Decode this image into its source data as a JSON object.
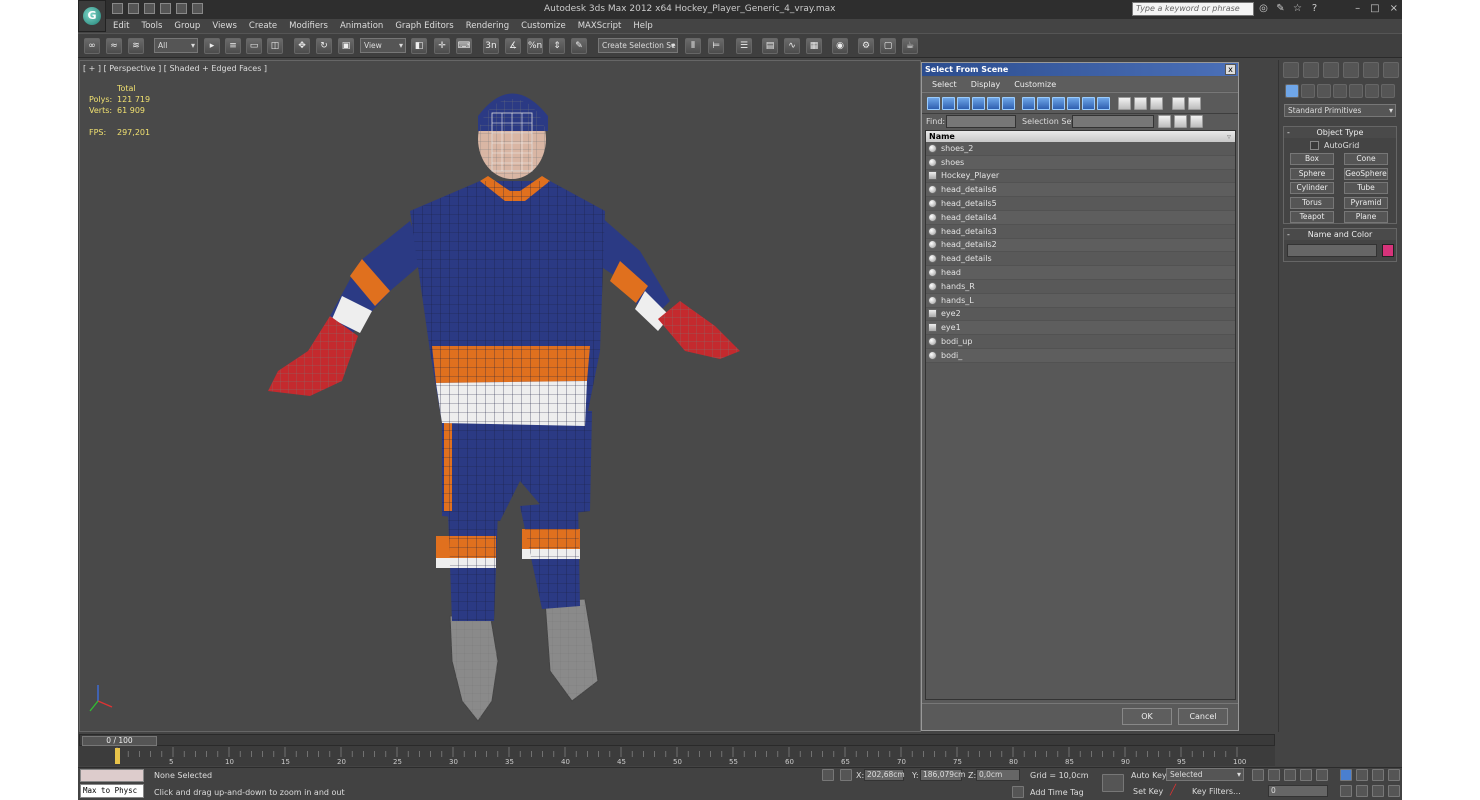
{
  "app": {
    "title": "Autodesk 3ds Max  2012 x64     Hockey_Player_Generic_4_vray.max",
    "logo_glyph": "G",
    "search_placeholder": "Type a keyword or phrase",
    "window_controls": [
      "–",
      "□",
      "×"
    ]
  },
  "menu": [
    "Edit",
    "Tools",
    "Group",
    "Views",
    "Create",
    "Modifiers",
    "Animation",
    "Graph Editors",
    "Rendering",
    "Customize",
    "MAXScript",
    "Help"
  ],
  "toolbar": {
    "filter": "All",
    "coord": "View",
    "selection_set": "Create Selection Se",
    "snap_labels": [
      "3n",
      "%n"
    ]
  },
  "viewport": {
    "label": "[ + ] [ Perspective ] [ Shaded + Edged Faces ]",
    "stats": {
      "header": "Total",
      "polys_label": "Polys:",
      "polys": "121 719",
      "verts_label": "Verts:",
      "verts": "61 909",
      "fps_label": "FPS:",
      "fps": "297,201"
    }
  },
  "dialog": {
    "title": "Select From Scene",
    "close": "x",
    "menu": [
      "Select",
      "Display",
      "Customize"
    ],
    "find_label": "Find:",
    "selection_set_label": "Selection Set:",
    "column": "Name",
    "items": [
      "shoes_2",
      "shoes",
      "Hockey_Player",
      "head_details6",
      "head_details5",
      "head_details4",
      "head_details3",
      "head_details2",
      "head_details",
      "head",
      "hands_R",
      "hands_L",
      "eye2",
      "eye1",
      "bodi_up",
      "bodi_"
    ],
    "group_items": [
      "Hockey_Player",
      "eye2",
      "eye1"
    ],
    "ok": "OK",
    "cancel": "Cancel"
  },
  "command_panel": {
    "category": "Standard Primitives",
    "object_type_title": "Object Type",
    "autogrid": "AutoGrid",
    "buttons": [
      "Box",
      "Cone",
      "Sphere",
      "GeoSphere",
      "Cylinder",
      "Tube",
      "Torus",
      "Pyramid",
      "Teapot",
      "Plane"
    ],
    "name_color_title": "Name and Color",
    "object_color": "#d6337a"
  },
  "timeline": {
    "slider": "0 / 100",
    "ticks": [
      5,
      10,
      15,
      20,
      25,
      30,
      35,
      40,
      45,
      50,
      55,
      60,
      65,
      70,
      75,
      80,
      85,
      90,
      95,
      100
    ]
  },
  "status": {
    "maxscript": "Max to Physc",
    "selection": "None Selected",
    "prompt": "Click and drag up-and-down to zoom in and out",
    "x_label": "X:",
    "x": "202,68cm",
    "y_label": "Y:",
    "y": "186,079cm",
    "z_label": "Z:",
    "z": "0,0cm",
    "grid": "Grid = 10,0cm",
    "add_time_tag": "Add Time Tag",
    "auto_key": "Auto Key",
    "set_key": "Set Key",
    "key_mode": "Selected",
    "key_filters": "Key Filters...",
    "frame": "0"
  },
  "colors": {
    "jersey_blue": "#2b3a84",
    "jersey_orange": "#e0701e",
    "glove_red": "#c42a2e",
    "stats_yellow": "#f0e070"
  }
}
